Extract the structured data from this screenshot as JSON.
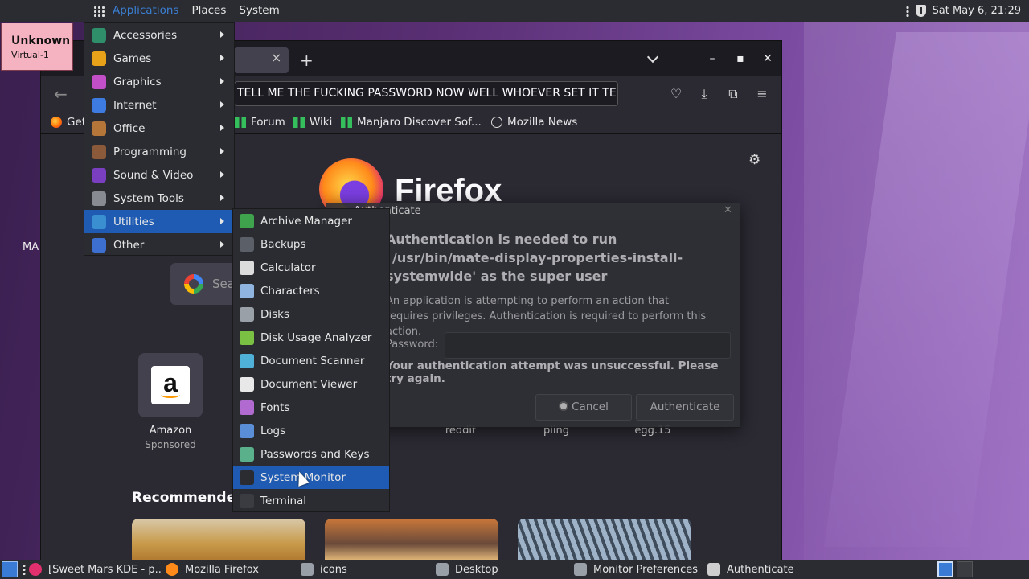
{
  "top_panel": {
    "menus": [
      "Applications",
      "Places",
      "System"
    ],
    "clock": "Sat May 6, 21:29"
  },
  "desktop": {
    "badge_title": "Unknown",
    "badge_sub": "Virtual-1",
    "label_fragment": "MA"
  },
  "firefox": {
    "url_text": "TELL ME THE FUCKING PASSWORD NOW WELL WHOEVER SET IT TELL US",
    "bookmarks": [
      "Get",
      "Forum",
      "Wiki",
      "Manjaro Discover Sof...",
      "Mozilla News"
    ],
    "brand": "Firefox",
    "search_placeholder": "Sea",
    "shortcuts": [
      {
        "label": "Amazon",
        "sub": "Sponsored"
      },
      {
        "label": "reddit"
      },
      {
        "label": "pling"
      },
      {
        "label": "egg.15"
      }
    ],
    "recommended": "Recommended"
  },
  "auth_dialog": {
    "title": "Authenticate",
    "heading": "Authentication is needed to run `/usr/bin/mate-display-properties-install-systemwide' as the super user",
    "body": "An application is attempting to perform an action that requires privileges. Authentication is required to perform this action.",
    "password_label": "Password:",
    "error": "Your authentication attempt was unsuccessful. Please try again.",
    "cancel": "Cancel",
    "authenticate": "Authenticate"
  },
  "app_menu": {
    "items": [
      {
        "label": "Accessories",
        "icon": "accessories-icon",
        "color": "#2f8f6b"
      },
      {
        "label": "Games",
        "icon": "games-icon",
        "color": "#e8a21a"
      },
      {
        "label": "Graphics",
        "icon": "graphics-icon",
        "color": "#c34fc8"
      },
      {
        "label": "Internet",
        "icon": "internet-icon",
        "color": "#3d7be0"
      },
      {
        "label": "Office",
        "icon": "office-icon",
        "color": "#b5763a"
      },
      {
        "label": "Programming",
        "icon": "programming-icon",
        "color": "#8a5a3a"
      },
      {
        "label": "Sound & Video",
        "icon": "sound-video-icon",
        "color": "#7a3fc0"
      },
      {
        "label": "System Tools",
        "icon": "system-tools-icon",
        "color": "#888c92"
      },
      {
        "label": "Utilities",
        "icon": "utilities-icon",
        "color": "#3a8fd0"
      },
      {
        "label": "Other",
        "icon": "other-icon",
        "color": "#3d6fd0"
      }
    ],
    "selected": "Utilities"
  },
  "utilities_menu": {
    "items": [
      {
        "label": "Archive Manager",
        "icon": "archive-manager-icon",
        "color": "#3fa34d"
      },
      {
        "label": "Backups",
        "icon": "backups-icon",
        "color": "#5a5f68"
      },
      {
        "label": "Calculator",
        "icon": "calculator-icon",
        "color": "#dcdcdc"
      },
      {
        "label": "Characters",
        "icon": "characters-icon",
        "color": "#8fb4e0"
      },
      {
        "label": "Disks",
        "icon": "disks-icon",
        "color": "#9aa0a8"
      },
      {
        "label": "Disk Usage Analyzer",
        "icon": "disk-usage-icon",
        "color": "#7ac143"
      },
      {
        "label": "Document Scanner",
        "icon": "document-scanner-icon",
        "color": "#4fb0d8"
      },
      {
        "label": "Document Viewer",
        "icon": "document-viewer-icon",
        "color": "#e8e8e8"
      },
      {
        "label": "Fonts",
        "icon": "fonts-icon",
        "color": "#b06ad0"
      },
      {
        "label": "Logs",
        "icon": "logs-icon",
        "color": "#5a8fd8"
      },
      {
        "label": "Passwords and Keys",
        "icon": "passwords-keys-icon",
        "color": "#5ab08a"
      },
      {
        "label": "System Monitor",
        "icon": "system-monitor-icon",
        "color": "#2a2c31"
      },
      {
        "label": "Terminal",
        "icon": "terminal-icon",
        "color": "#3a3c42"
      }
    ],
    "selected": "System Monitor"
  },
  "taskbar": {
    "items": [
      {
        "label": "[Sweet Mars KDE - p...",
        "icon": "firefox-icon"
      },
      {
        "label": "Mozilla Firefox",
        "icon": "firefox-icon"
      },
      {
        "label": "icons",
        "icon": "folder-icon"
      },
      {
        "label": "Desktop",
        "icon": "window-icon"
      },
      {
        "label": "Monitor Preferences",
        "icon": "display-icon"
      },
      {
        "label": "Authenticate",
        "icon": "auth-icon"
      }
    ]
  }
}
